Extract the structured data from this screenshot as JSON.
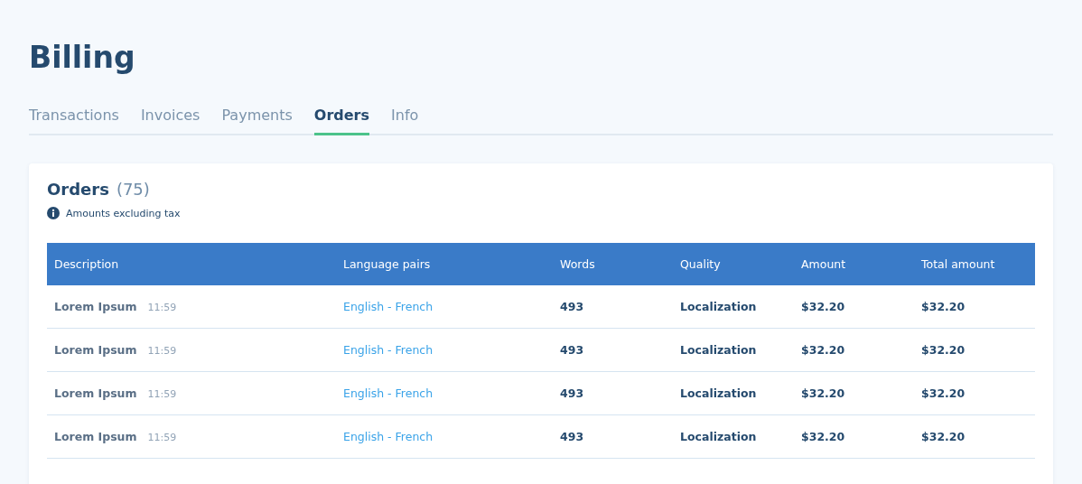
{
  "page": {
    "title": "Billing"
  },
  "tabs": [
    {
      "label": "Transactions",
      "selected": false
    },
    {
      "label": "Invoices",
      "selected": false
    },
    {
      "label": "Payments",
      "selected": false
    },
    {
      "label": "Orders",
      "selected": true
    },
    {
      "label": "Info",
      "selected": false
    }
  ],
  "card": {
    "title": "Orders",
    "count": "(75)",
    "note": "Amounts excluding tax"
  },
  "table": {
    "columns": [
      "Description",
      "Language pairs",
      "Words",
      "Quality",
      "Amount",
      "Total amount"
    ],
    "rows": [
      {
        "description": "Lorem Ipsum",
        "time": "11:59",
        "language_pair": "English - French",
        "words": "493",
        "quality": "Localization",
        "amount": "$32.20",
        "total_amount": "$32.20"
      },
      {
        "description": "Lorem Ipsum",
        "time": "11:59",
        "language_pair": "English - French",
        "words": "493",
        "quality": "Localization",
        "amount": "$32.20",
        "total_amount": "$32.20"
      },
      {
        "description": "Lorem Ipsum",
        "time": "11:59",
        "language_pair": "English - French",
        "words": "493",
        "quality": "Localization",
        "amount": "$32.20",
        "total_amount": "$32.20"
      },
      {
        "description": "Lorem Ipsum",
        "time": "11:59",
        "language_pair": "English - French",
        "words": "493",
        "quality": "Localization",
        "amount": "$32.20",
        "total_amount": "$32.20"
      }
    ]
  }
}
